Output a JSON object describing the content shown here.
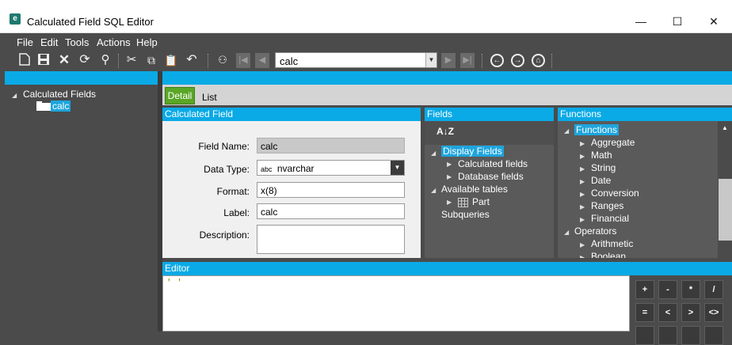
{
  "window": {
    "title": "Calculated Field SQL Editor",
    "icon_letter": "e",
    "minimize": "—",
    "maximize": "☐",
    "close": "✕"
  },
  "menu": [
    "File",
    "Edit",
    "Tools",
    "Actions",
    "Help"
  ],
  "toolbar": {
    "record_combo_value": "calc"
  },
  "tree": {
    "root_label": "Calculated Fields",
    "child_label": "calc"
  },
  "tabs": {
    "detail": "Detail",
    "list": "List"
  },
  "calculated_field": {
    "header": "Calculated Field",
    "field_name_label": "Field Name:",
    "field_name_value": "calc",
    "data_type_label": "Data Type:",
    "data_type_prefix": "abc",
    "data_type_value": "nvarchar",
    "format_label": "Format:",
    "format_value": "x(8)",
    "label_label": "Label:",
    "label_value": "calc",
    "description_label": "Description:",
    "description_value": ""
  },
  "fields": {
    "header": "Fields",
    "sort_icon_text": "A↓Z",
    "display_fields": "Display Fields",
    "calculated_fields": "Calculated fields",
    "database_fields": "Database fields",
    "available_tables": "Available tables",
    "part": "Part",
    "subqueries": "Subqueries"
  },
  "functions": {
    "header": "Functions",
    "functions_node": "Functions",
    "items": [
      "Aggregate",
      "Math",
      "String",
      "Date",
      "Conversion",
      "Ranges",
      "Financial"
    ],
    "operators_node": "Operators",
    "operator_items": [
      "Arithmetic",
      "Boolean"
    ]
  },
  "editor": {
    "header": "Editor",
    "content": "' '"
  },
  "operators": {
    "row1": [
      "+",
      "-",
      "*",
      "/"
    ],
    "row2": [
      "=",
      "<",
      ">",
      "<>"
    ]
  }
}
